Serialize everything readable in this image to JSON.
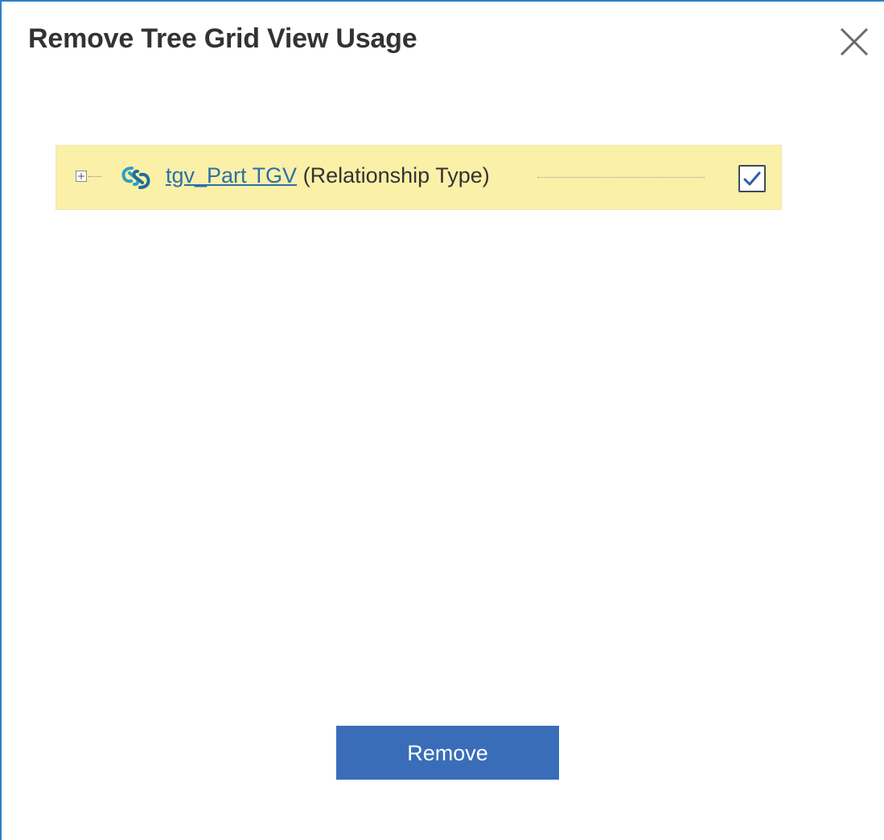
{
  "dialog": {
    "title": "Remove Tree Grid View Usage",
    "close_icon": "close-icon"
  },
  "tree": {
    "items": [
      {
        "expander_icon": "plus-box-icon",
        "type_icon": "relationship-icon",
        "link_text": "tgv_Part TGV",
        "type_label": "(Relationship Type)",
        "checked": true,
        "highlight_color": "#faf0a8"
      }
    ]
  },
  "footer": {
    "remove_label": "Remove",
    "button_color": "#3a6db8"
  }
}
